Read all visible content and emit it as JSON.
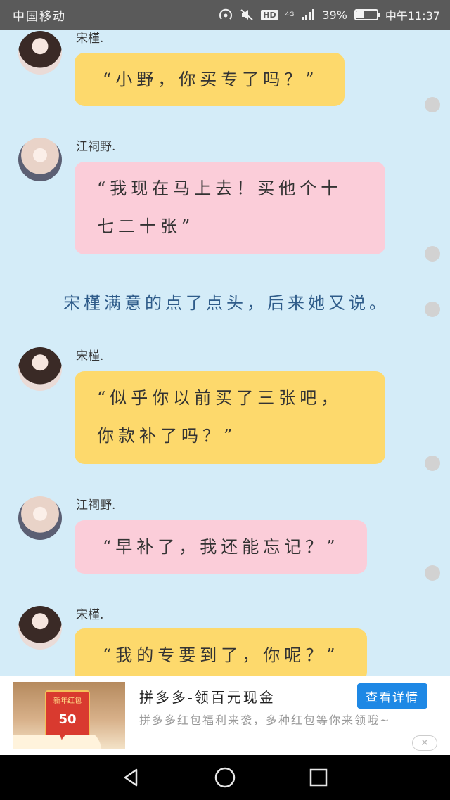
{
  "status_bar": {
    "carrier": "中国移动",
    "network": "4G",
    "hd": "HD",
    "battery_percent": "39%",
    "battery_level": 0.39,
    "time": "中午11:37"
  },
  "chat": {
    "messages": [
      {
        "sender": "宋槿.",
        "text": "“小野，你买专了吗？”",
        "color": "yellow"
      },
      {
        "sender": "江祠野.",
        "text": "“我现在马上去！买他个十\n七二十张”",
        "color": "pink"
      },
      {
        "sender": "宋槿.",
        "text": "“似乎你以前买了三张吧，\n你款补了吗？”",
        "color": "yellow"
      },
      {
        "sender": "江祠野.",
        "text": "“早补了，我还能忘记？”",
        "color": "pink"
      },
      {
        "sender": "宋槿.",
        "text": "“我的专要到了，你呢？”",
        "color": "yellow"
      }
    ],
    "narration": "宋槿满意的点了点头，后来她又说。"
  },
  "ad": {
    "title": "拼多多-领百元现金",
    "description": "拼多多红包福利来袭，多种红包等你来领哦~",
    "button_label": "查看详情",
    "thumb_badge": "新年红包",
    "thumb_amount": "50",
    "close_icon": "close-icon"
  },
  "nav": {
    "back_icon": "back-icon",
    "home_icon": "home-icon",
    "recents_icon": "recents-icon"
  },
  "colors": {
    "background": "#d4ecf8",
    "bubble_yellow": "#fdd96c",
    "bubble_pink": "#fbcdd9",
    "narration": "#2f5c8a",
    "ad_button": "#1e88e5"
  }
}
